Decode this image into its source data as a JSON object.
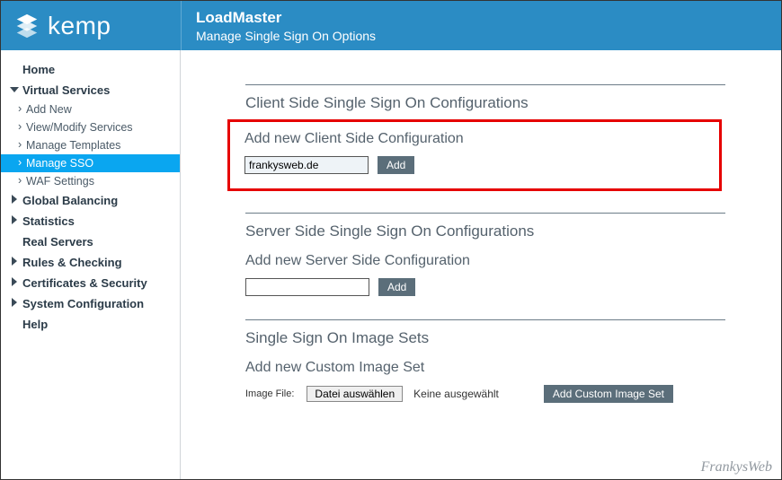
{
  "brand": "kemp",
  "header": {
    "title": "LoadMaster",
    "subtitle": "Manage Single Sign On Options"
  },
  "sidebar": {
    "home": "Home",
    "virtual_services": "Virtual Services",
    "vs_children": {
      "add_new": "Add New",
      "view_modify": "View/Modify Services",
      "manage_templates": "Manage Templates",
      "manage_sso": "Manage SSO",
      "waf_settings": "WAF Settings"
    },
    "global_balancing": "Global Balancing",
    "statistics": "Statistics",
    "real_servers": "Real Servers",
    "rules_checking": "Rules & Checking",
    "certs_security": "Certificates & Security",
    "system_config": "System Configuration",
    "help": "Help"
  },
  "main": {
    "client_section_title": "Client Side Single Sign On Configurations",
    "client_add_heading": "Add new Client Side Configuration",
    "client_input_value": "frankysweb.de",
    "client_add_btn": "Add",
    "server_section_title": "Server Side Single Sign On Configurations",
    "server_add_heading": "Add new Server Side Configuration",
    "server_input_value": "",
    "server_add_btn": "Add",
    "imageset_title": "Single Sign On Image Sets",
    "imageset_heading": "Add new Custom Image Set",
    "imageset_file_label": "Image File:",
    "imageset_file_button": "Datei auswählen",
    "imageset_file_status": "Keine ausgewählt",
    "imageset_add_btn": "Add Custom Image Set"
  },
  "watermark": "FrankysWeb"
}
